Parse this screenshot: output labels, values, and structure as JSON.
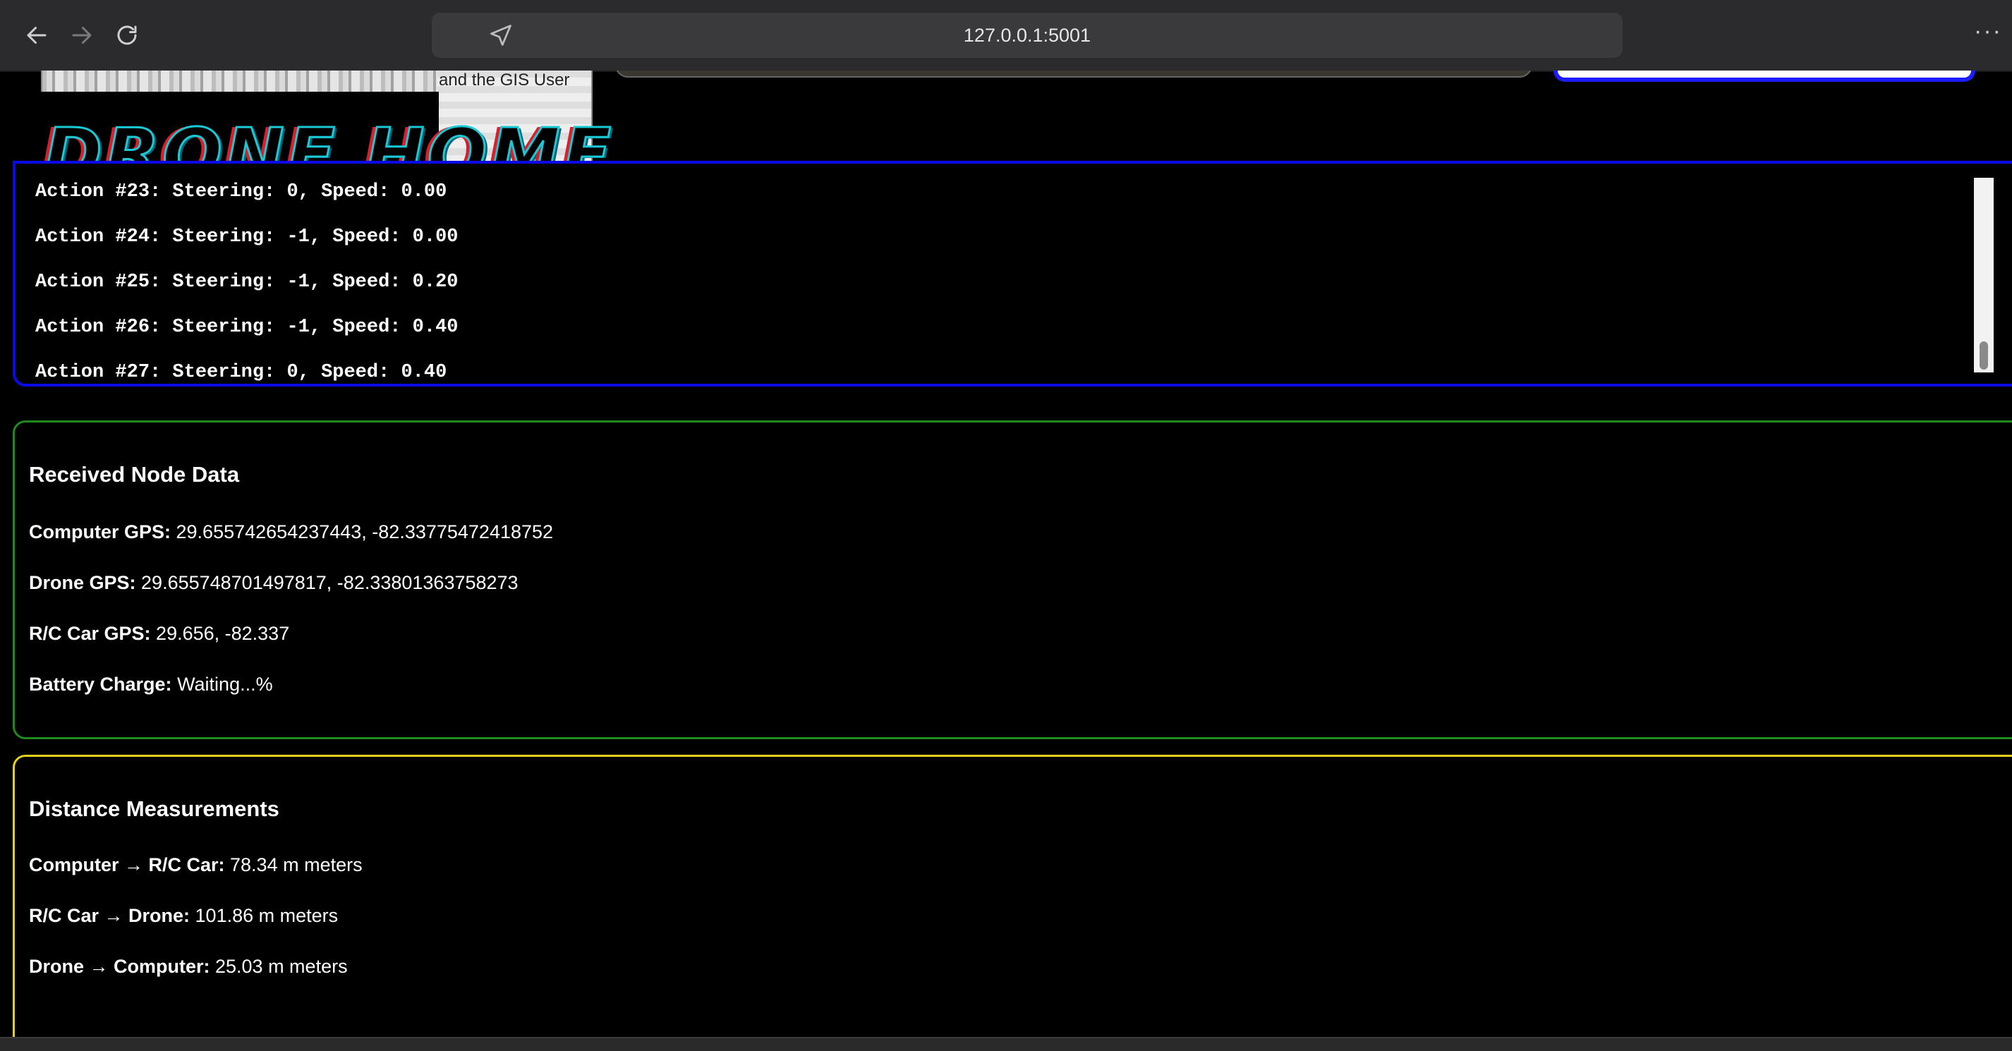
{
  "browser": {
    "url": "127.0.0.1:5001",
    "more_label": "···"
  },
  "header": {
    "logo_text": "DRONE HOME",
    "map_caption": "and the GIS User"
  },
  "actions": [
    "Action #23: Steering: 0, Speed: 0.00",
    "Action #24: Steering: -1, Speed: 0.00",
    "Action #25: Steering: -1, Speed: 0.20",
    "Action #26: Steering: -1, Speed: 0.40",
    "Action #27: Steering: 0, Speed: 0.40"
  ],
  "node_data": {
    "title": "Received Node Data",
    "computer_gps": {
      "label": "Computer GPS:",
      "value": " 29.655742654237443, -82.33775472418752"
    },
    "drone_gps": {
      "label": "Drone GPS:",
      "value": " 29.655748701497817, -82.33801363758273"
    },
    "rc_car_gps": {
      "label": "R/C Car GPS:",
      "value": " 29.656, -82.337"
    },
    "battery": {
      "label": "Battery Charge:",
      "value": " Waiting...%"
    }
  },
  "distances": {
    "title": "Distance Measurements",
    "computer_rc": {
      "label": "Computer → R/C Car:",
      "value": " 78.34 m meters"
    },
    "rc_drone": {
      "label": "R/C Car → Drone:",
      "value": " 101.86 m meters"
    },
    "drone_computer": {
      "label": "Drone → Computer:",
      "value": " 25.03 m meters"
    }
  },
  "colors": {
    "actions_border": "#0a0ae6",
    "node_border": "#1f8a1f",
    "distance_border": "#e3d11c",
    "logo_cyan": "#19c9d6",
    "logo_red": "#e01c2a"
  },
  "icons": {
    "back": "back-arrow-icon",
    "forward": "forward-arrow-icon",
    "reload": "reload-icon",
    "location": "location-arrow-icon",
    "more": "more-dots-icon"
  }
}
